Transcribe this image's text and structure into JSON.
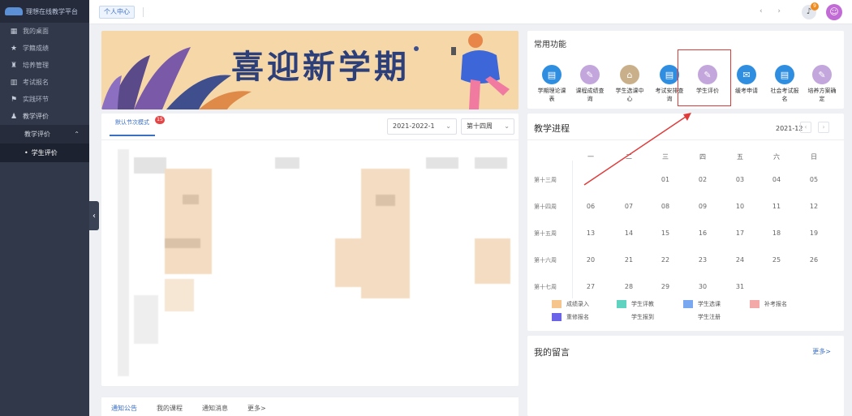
{
  "sidebar": {
    "logo_text": "理想在线教学平台",
    "items": [
      {
        "label": "我的桌面",
        "icon": "dashboard-icon",
        "glyph": "▦"
      },
      {
        "label": "学籍成绩",
        "icon": "grades-icon",
        "glyph": "★"
      },
      {
        "label": "培养管理",
        "icon": "trophy-icon",
        "glyph": "♜"
      },
      {
        "label": "考试报名",
        "icon": "exam-icon",
        "glyph": "▥"
      },
      {
        "label": "实践环节",
        "icon": "flag-icon",
        "glyph": "⚑"
      },
      {
        "label": "教学评价",
        "icon": "user-icon",
        "glyph": "♟"
      }
    ],
    "submenu_head": "教学评价",
    "submenu_item": "学生评价",
    "collapse_glyph": "‹"
  },
  "topbar": {
    "tab_label": "个人中心",
    "nav_glyphs": "‹ ›",
    "bell_badge": "9"
  },
  "banner": {
    "title": "喜迎新学期"
  },
  "course_panel": {
    "tab_label": "默认节次模式",
    "badge": "15",
    "term": "2021-2022-1",
    "week": "第十四周"
  },
  "notice_bar": {
    "tabs": [
      "通知公告",
      "我的课程",
      "通知消息",
      "更多>"
    ]
  },
  "functions": {
    "title": "常用功能",
    "items": [
      {
        "label": "学期理论课表",
        "color": "#2f8ee0",
        "glyph": "▤"
      },
      {
        "label": "课程成绩查询",
        "color": "#c3a6dc",
        "glyph": "✎"
      },
      {
        "label": "学生选课中心",
        "color": "#c9b08a",
        "glyph": "⌂"
      },
      {
        "label": "考试安排查询",
        "color": "#2f8ee0",
        "glyph": "▤"
      },
      {
        "label": "学生评价",
        "color": "#c3a6dc",
        "glyph": "✎"
      },
      {
        "label": "缓考申请",
        "color": "#2f8ee0",
        "glyph": "✉"
      },
      {
        "label": "社会考试报名",
        "color": "#2f8ee0",
        "glyph": "▤"
      },
      {
        "label": "培养方案确定",
        "color": "#c3a6dc",
        "glyph": "✎"
      }
    ]
  },
  "progress": {
    "title": "教学进程",
    "month": "2021-12",
    "weekdays": [
      "一",
      "二",
      "三",
      "四",
      "五",
      "六",
      "日"
    ],
    "weeks": [
      {
        "label": "第十三周",
        "days": [
          "",
          "",
          "01",
          "02",
          "03",
          "04",
          "05"
        ]
      },
      {
        "label": "第十四周",
        "days": [
          "06",
          "07",
          "08",
          "09",
          "10",
          "11",
          "12"
        ]
      },
      {
        "label": "第十五周",
        "days": [
          "13",
          "14",
          "15",
          "16",
          "17",
          "18",
          "19"
        ]
      },
      {
        "label": "第十六周",
        "days": [
          "20",
          "21",
          "22",
          "23",
          "24",
          "25",
          "26"
        ]
      },
      {
        "label": "第十七周",
        "days": [
          "27",
          "28",
          "29",
          "30",
          "31",
          "",
          ""
        ]
      }
    ],
    "legend": [
      {
        "label": "成绩录入",
        "color": "#f6c48d"
      },
      {
        "label": "学生评教",
        "color": "#5fd3bf"
      },
      {
        "label": "学生选课",
        "color": "#7aa8f0"
      },
      {
        "label": "补考报名",
        "color": "#f4a9a9"
      },
      {
        "label": "重修报名",
        "color": "#6b63e8"
      },
      {
        "label": "学生报到",
        "color": ""
      },
      {
        "label": "学生注册",
        "color": ""
      }
    ]
  },
  "messages": {
    "title": "我的留言",
    "more": "更多>"
  }
}
